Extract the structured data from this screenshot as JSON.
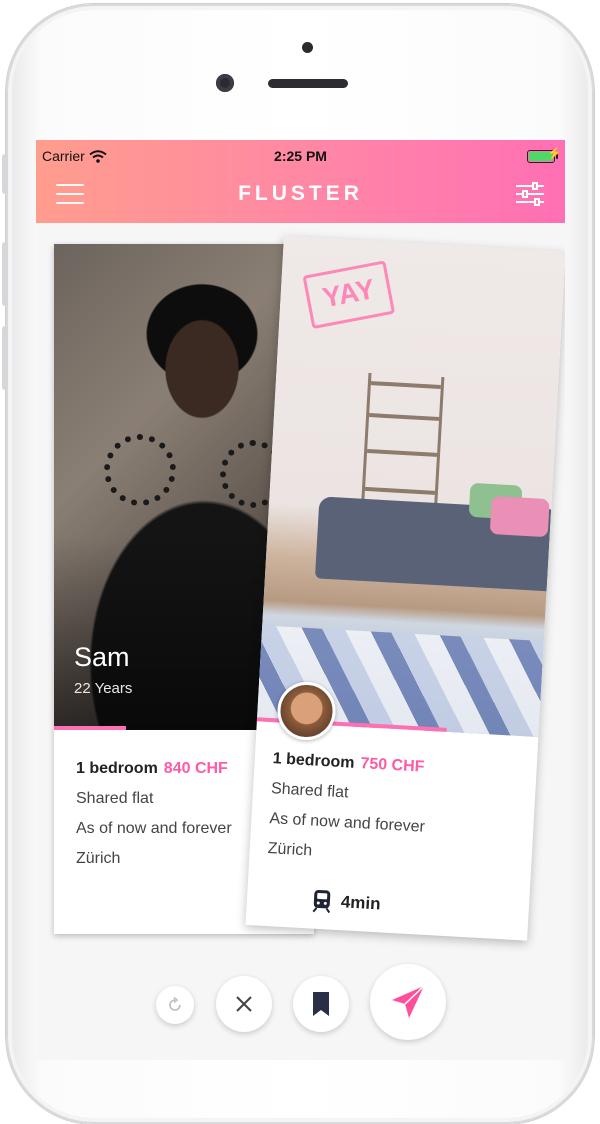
{
  "status_bar": {
    "carrier": "Carrier",
    "time": "2:25 PM"
  },
  "header": {
    "title": "FLUSTER"
  },
  "profile_card": {
    "name": "Sam",
    "age": "22 Years",
    "bedrooms": "1 bedroom",
    "price": "840 CHF",
    "type": "Shared flat",
    "availability": "As of now and forever",
    "city": "Zürich"
  },
  "flat_card": {
    "stamp": "YAY",
    "bedrooms": "1 bedroom",
    "price": "750 CHF",
    "type": "Shared flat",
    "availability": "As of now and forever",
    "city": "Zürich",
    "commute": "4min"
  },
  "colors": {
    "accent": "#ff6fb4",
    "header_start": "#ff9d8d",
    "header_end": "#ff6fb4",
    "send_icon": "#ff4f9a"
  },
  "actions": [
    "undo-icon",
    "close-icon",
    "bookmark-icon",
    "send-icon"
  ]
}
